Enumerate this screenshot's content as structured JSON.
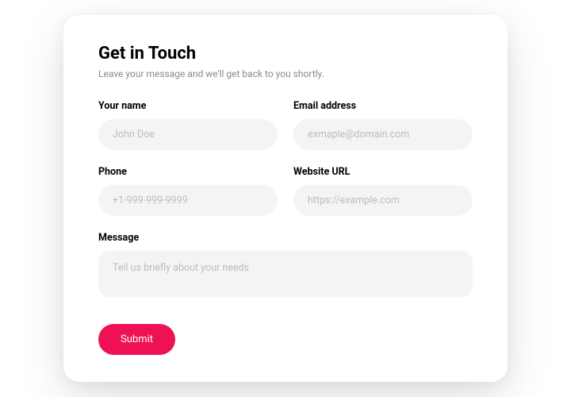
{
  "header": {
    "title": "Get in Touch",
    "subtitle": "Leave your message and we'll get back to you shortly."
  },
  "fields": {
    "name": {
      "label": "Your name",
      "placeholder": "John Doe",
      "value": ""
    },
    "email": {
      "label": "Email address",
      "placeholder": "exmaple@domain.com",
      "value": ""
    },
    "phone": {
      "label": "Phone",
      "placeholder": "+1-999-999-9999",
      "value": ""
    },
    "website": {
      "label": "Website URL",
      "placeholder": "https://example.com",
      "value": ""
    },
    "message": {
      "label": "Message",
      "placeholder": "Tell us briefly about your needs",
      "value": ""
    }
  },
  "actions": {
    "submit_label": "Submit"
  },
  "colors": {
    "accent": "#ee1153",
    "input_bg": "#f4f4f4",
    "placeholder": "#bdbdbd",
    "subtitle": "#8a8a8a"
  }
}
